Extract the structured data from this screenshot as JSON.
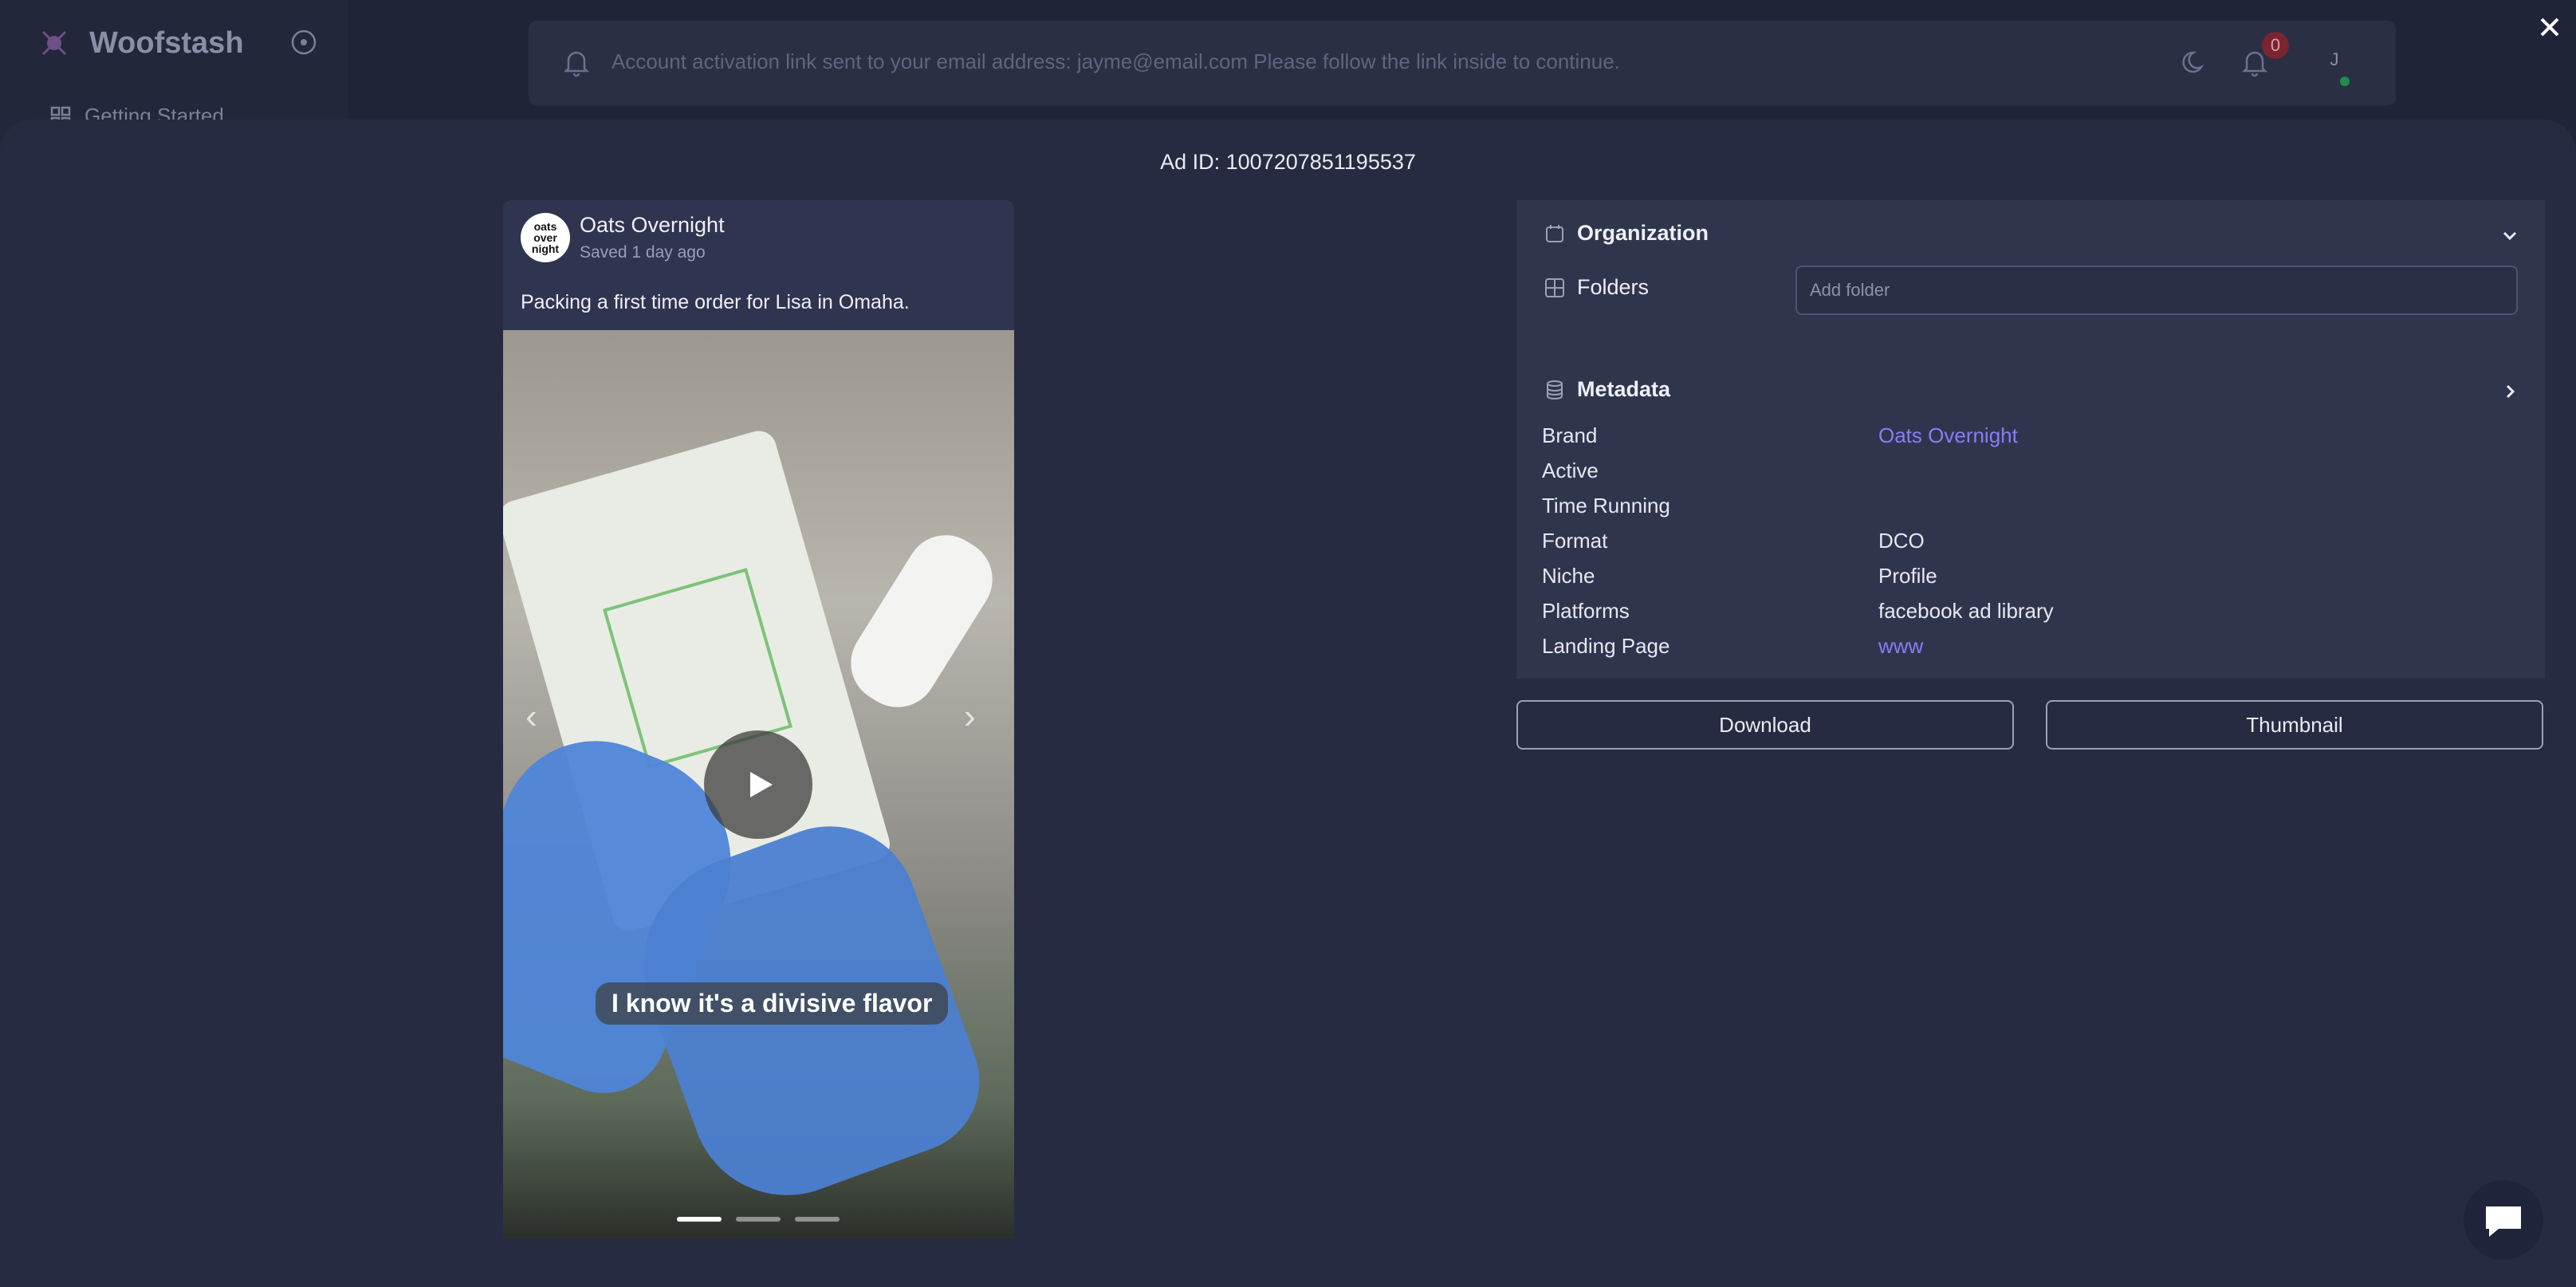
{
  "app": {
    "name": "Woofstash",
    "sidebar": {
      "items": [
        {
          "label": "Getting Started"
        }
      ]
    },
    "notification_bar": {
      "message": "Account activation link sent to your email address: jayme@email.com Please follow the link inside to continue.",
      "notification_count": "0",
      "avatar_initial": "J"
    }
  },
  "modal": {
    "ad_id_label": "Ad ID: 1007207851195537",
    "ad": {
      "brand_name": "Oats Overnight",
      "brand_logo_text": [
        "oats",
        "over",
        "night"
      ],
      "saved": "Saved 1 day ago",
      "caption": "Packing a first time order for Lisa in Omaha.",
      "video_subtitle": "I know it's a divisive flavor",
      "carousel": {
        "slides": 3,
        "active": 0
      }
    },
    "organization": {
      "title": "Organization",
      "folders_label": "Folders",
      "folder_placeholder": "Add folder"
    },
    "metadata": {
      "title": "Metadata",
      "rows": [
        {
          "label": "Brand",
          "value": "Oats Overnight",
          "link": true
        },
        {
          "label": "Active",
          "value": ""
        },
        {
          "label": "Time Running",
          "value": ""
        },
        {
          "label": "Format",
          "value": "DCO"
        },
        {
          "label": "Niche",
          "value": "Profile"
        },
        {
          "label": "Platforms",
          "value": "facebook ad library"
        },
        {
          "label": "Landing Page",
          "value": "www",
          "link": true
        }
      ]
    },
    "buttons": {
      "download": "Download",
      "thumbnail": "Thumbnail"
    }
  },
  "colors": {
    "accent_link": "#8b7cf2",
    "modal_bg": "#262b41",
    "panel_bg": "#30354e",
    "badge": "#7a2430"
  }
}
